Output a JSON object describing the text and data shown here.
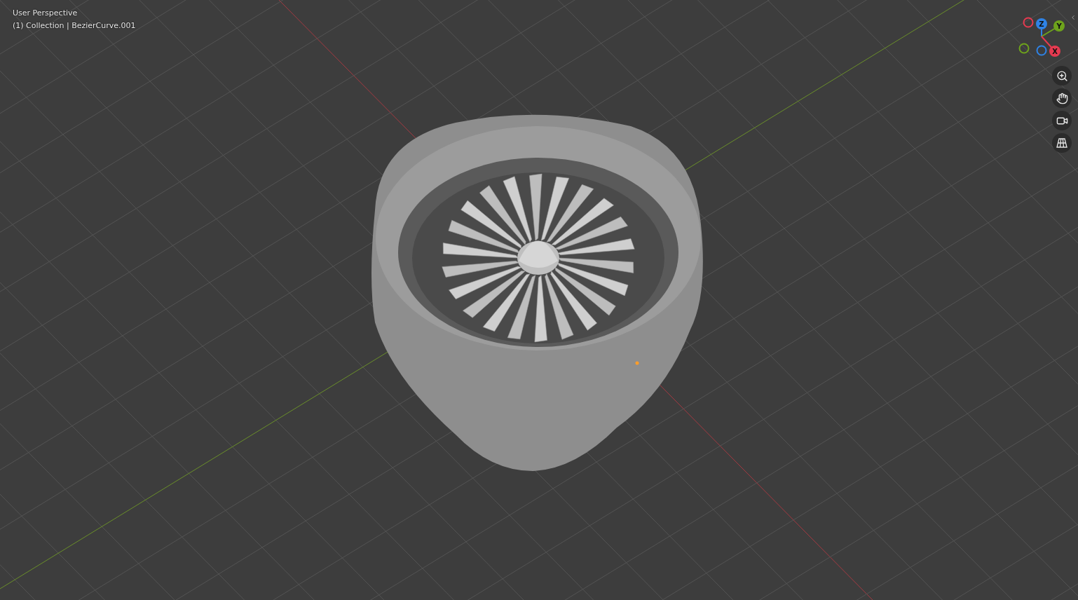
{
  "viewport": {
    "view_name": "User Perspective",
    "object_info": "(1) Collection | BezierCurve.001"
  },
  "gizmo": {
    "axes": [
      {
        "label": "Z",
        "color": "#2f83e6"
      },
      {
        "label": "Y",
        "color": "#6ea31c"
      },
      {
        "label": "X",
        "color": "#e63a50"
      }
    ]
  }
}
